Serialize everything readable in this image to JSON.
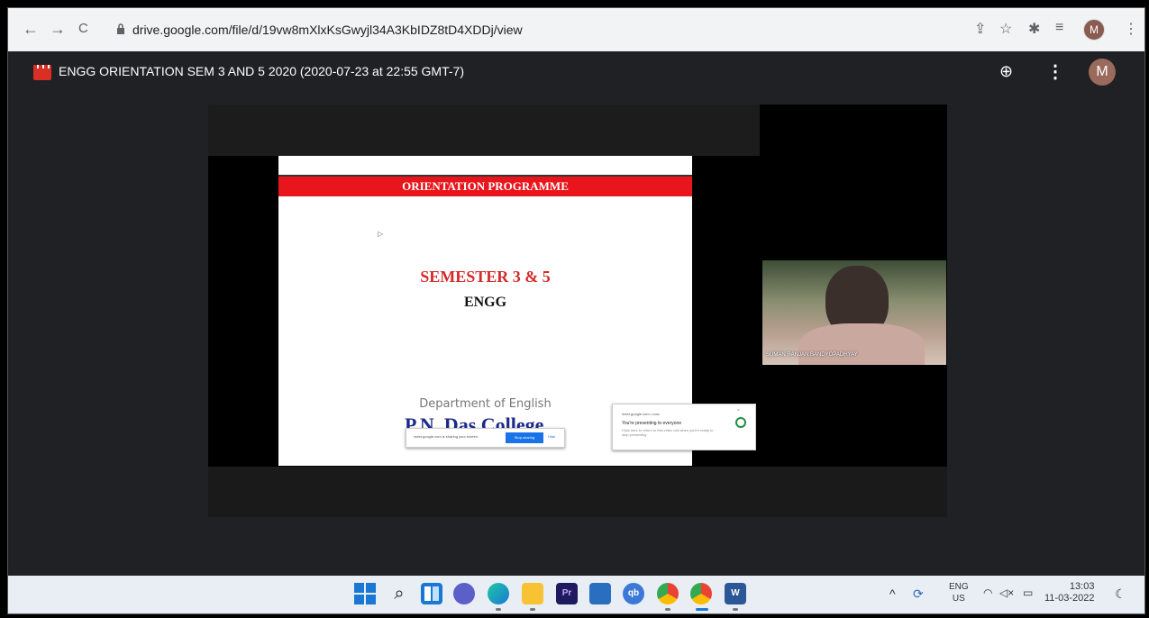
{
  "browser": {
    "url": "drive.google.com/file/d/19vw8mXlxKsGwyjl34A3KbIDZ8tD4XDDj/view",
    "avatar_letter": "M",
    "back": "←",
    "forward": "→",
    "reload": "C",
    "share_icon": "⇪",
    "star_icon": "☆",
    "extensions_icon": "✱",
    "playlist_icon": "≡",
    "menu_icon": "⋮"
  },
  "drive": {
    "file_title": "ENGG ORIENTATION SEM 3 AND 5 2020 (2020-07-23 at 22:55 GMT-7)",
    "add_shortcut_icon": "⊕",
    "more_icon": "⋮",
    "avatar_letter": "M"
  },
  "slide": {
    "banner": "ORIENTATION PROGRAMME",
    "semester": "SEMESTER 3 & 5",
    "subject": "ENGG",
    "department": "Department of English",
    "college": "P.N. Das College"
  },
  "share_bar": {
    "text": "meet.google.com is sharing your screen.",
    "stop": "Stop sharing",
    "hide": "Hide"
  },
  "popup": {
    "source": "meet.google.com • now",
    "title": "You're presenting to everyone",
    "body": "Click here to return to this video call when you're ready to stop presenting",
    "close": "×"
  },
  "participant": {
    "name": "SUMAN RANJAN BANDYOPADHYAY"
  },
  "taskbar": {
    "apps": [
      "windows-start",
      "search",
      "file-explorer-panes",
      "teams-chat",
      "edge",
      "file-explorer",
      "premiere-pro",
      "calculator",
      "qbittorrent",
      "chrome-profile-1",
      "chrome-profile-2",
      "word"
    ],
    "pr_label": "Pr",
    "qb_label": "qb",
    "w_label": "W",
    "lang_line1": "ENG",
    "lang_line2": "US",
    "time": "13:03",
    "date": "11-03-2022",
    "chevron": "^",
    "wifi_icon": "◠",
    "volume_icon": "◁×",
    "battery_icon": "▭",
    "notif_icon": "☾"
  }
}
